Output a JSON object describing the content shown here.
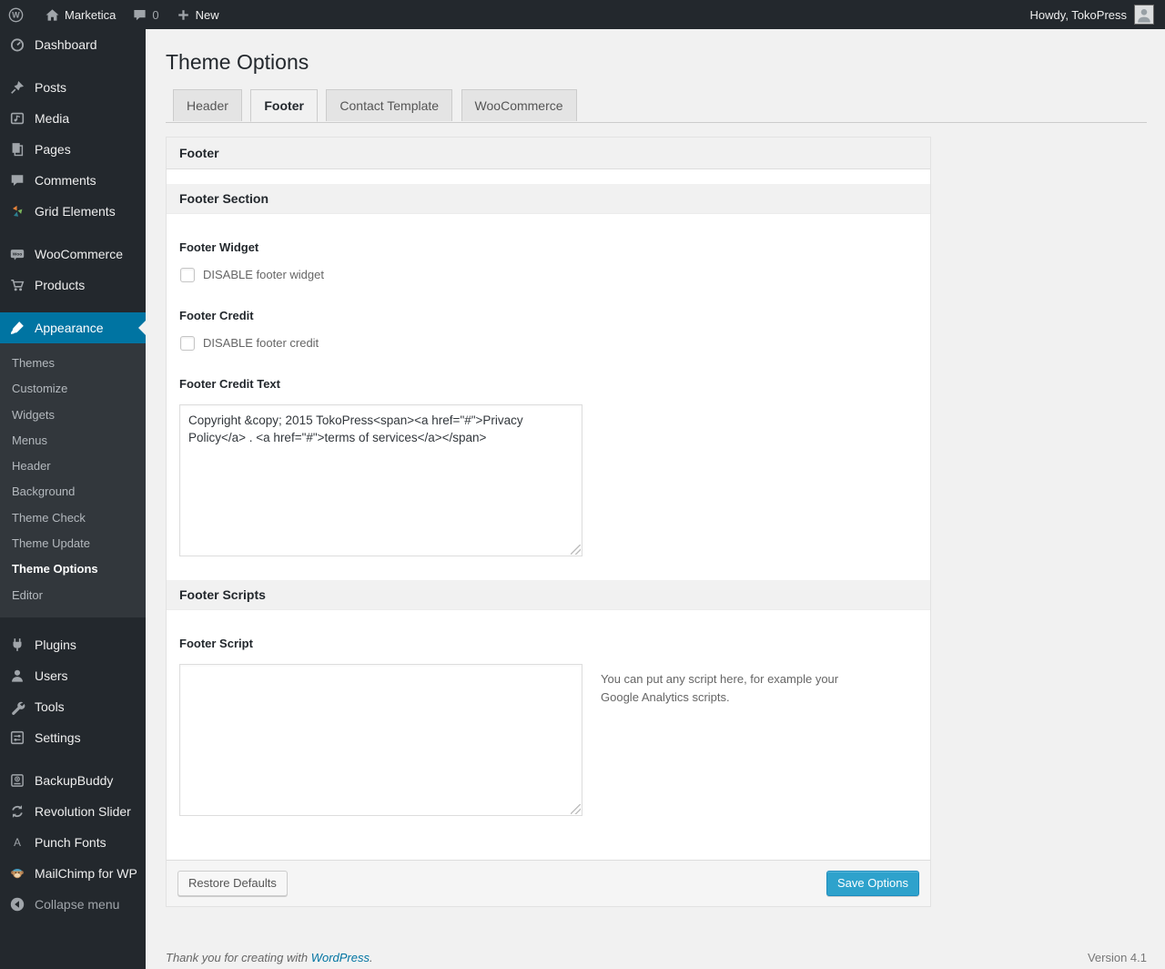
{
  "colors": {
    "accent_blue": "#0074a2",
    "primary_button": "#2ea2cc",
    "admin_bar_bg": "#23282d",
    "content_bg": "#f1f1f1"
  },
  "icons": {
    "wp_logo_letter": "W",
    "woo_badge": "Woo",
    "punch_fonts_letter": "A"
  },
  "admin_bar": {
    "site_name": "Marketica",
    "comment_count": "0",
    "new_label": "New",
    "howdy": "Howdy, TokoPress"
  },
  "sidebar": {
    "items": [
      {
        "label": "Dashboard"
      },
      {
        "label": "Posts"
      },
      {
        "label": "Media"
      },
      {
        "label": "Pages"
      },
      {
        "label": "Comments"
      },
      {
        "label": "Grid Elements"
      },
      {
        "label": "WooCommerce"
      },
      {
        "label": "Products"
      },
      {
        "label": "Appearance"
      },
      {
        "label": "Plugins"
      },
      {
        "label": "Users"
      },
      {
        "label": "Tools"
      },
      {
        "label": "Settings"
      },
      {
        "label": "BackupBuddy"
      },
      {
        "label": "Revolution Slider"
      },
      {
        "label": "Punch Fonts"
      },
      {
        "label": "MailChimp for WP"
      },
      {
        "label": "Collapse menu"
      }
    ],
    "appearance_submenu": [
      {
        "label": "Themes"
      },
      {
        "label": "Customize"
      },
      {
        "label": "Widgets"
      },
      {
        "label": "Menus"
      },
      {
        "label": "Header"
      },
      {
        "label": "Background"
      },
      {
        "label": "Theme Check"
      },
      {
        "label": "Theme Update"
      },
      {
        "label": "Theme Options"
      },
      {
        "label": "Editor"
      }
    ]
  },
  "page": {
    "title": "Theme Options",
    "tabs": [
      {
        "label": "Header"
      },
      {
        "label": "Footer"
      },
      {
        "label": "Contact Template"
      },
      {
        "label": "WooCommerce"
      }
    ]
  },
  "panel": {
    "title": "Footer",
    "section1": {
      "title": "Footer Section",
      "footer_widget_label": "Footer Widget",
      "footer_widget_checkbox": "DISABLE footer widget",
      "footer_credit_label": "Footer Credit",
      "footer_credit_checkbox": "DISABLE footer credit",
      "footer_credit_text_label": "Footer Credit Text",
      "footer_credit_text_value": "Copyright &copy; 2015 TokoPress<span><a href=\"#\">Privacy Policy</a> . <a href=\"#\">terms of services</a></span>"
    },
    "section2": {
      "title": "Footer Scripts",
      "footer_script_label": "Footer Script",
      "footer_script_value": "",
      "footer_script_note": "You can put any script here, for example your Google Analytics scripts."
    },
    "restore_button": "Restore Defaults",
    "save_button": "Save Options"
  },
  "footer": {
    "thankyou_prefix": "Thank you for creating with ",
    "wordpress_link": "WordPress",
    "thankyou_suffix": ".",
    "version": "Version 4.1"
  }
}
